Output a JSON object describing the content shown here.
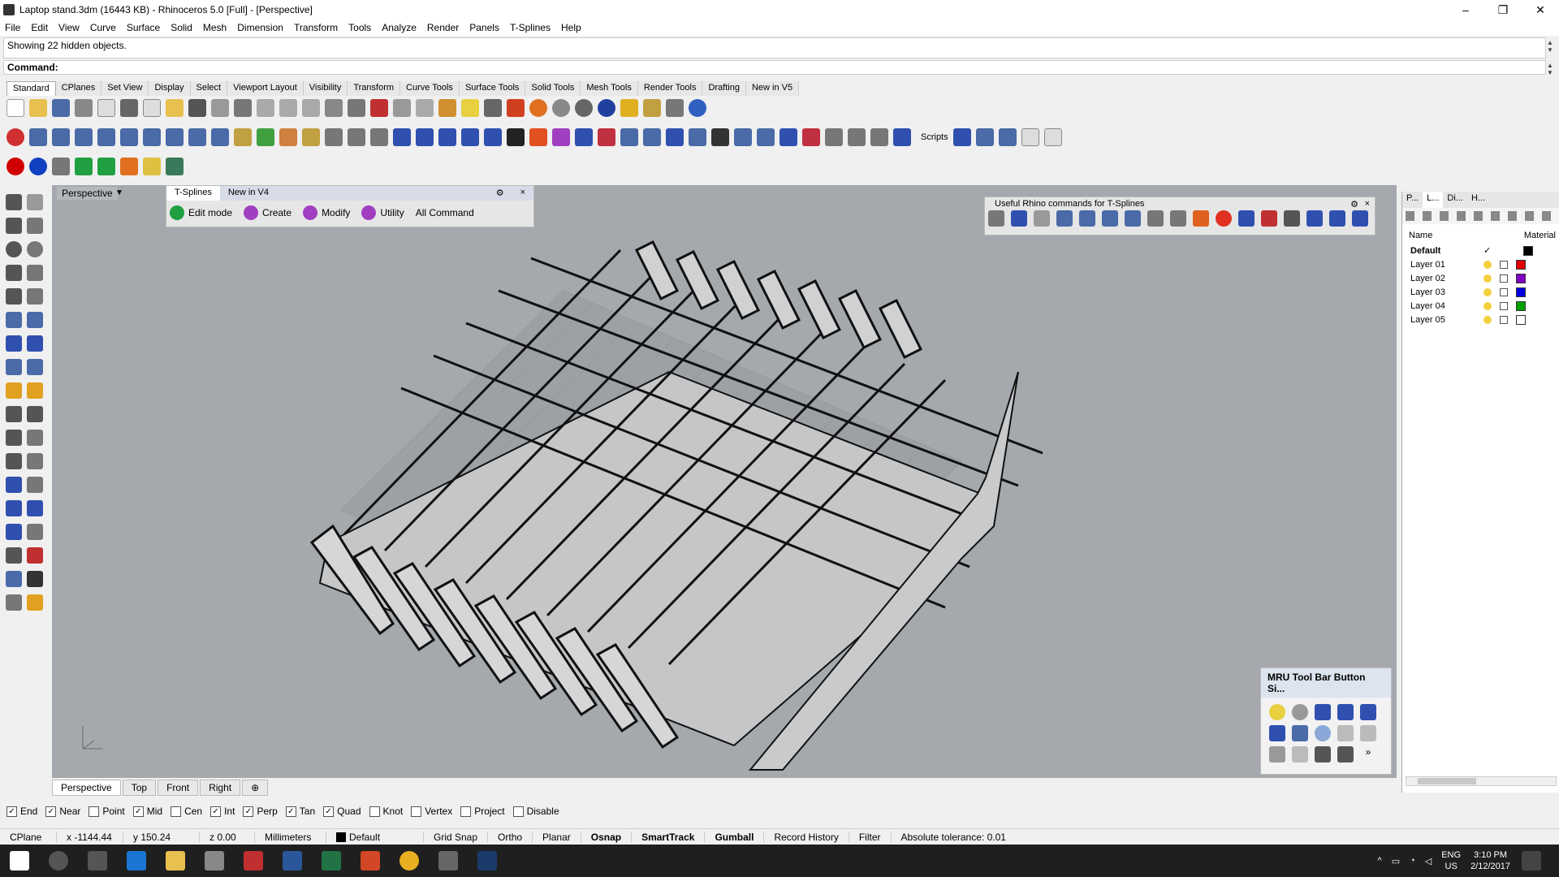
{
  "window": {
    "title": "Laptop stand.3dm (16443 KB) - Rhinoceros 5.0 [Full] - [Perspective]",
    "minimize": "–",
    "maximize": "❐",
    "close": "✕"
  },
  "menu": [
    "File",
    "Edit",
    "View",
    "Curve",
    "Surface",
    "Solid",
    "Mesh",
    "Dimension",
    "Transform",
    "Tools",
    "Analyze",
    "Render",
    "Panels",
    "T-Splines",
    "Help"
  ],
  "command": {
    "history": "Showing 22 hidden objects.",
    "prompt": "Command:"
  },
  "toolbar_tabs": [
    "Standard",
    "CPlanes",
    "Set View",
    "Display",
    "Select",
    "Viewport Layout",
    "Visibility",
    "Transform",
    "Curve Tools",
    "Surface Tools",
    "Solid Tools",
    "Mesh Tools",
    "Render Tools",
    "Drafting",
    "New in V5"
  ],
  "scripts_label": "Scripts",
  "viewport": {
    "label": "Perspective",
    "tabs": [
      "Perspective",
      "Top",
      "Front",
      "Right"
    ]
  },
  "tsplines_panel": {
    "tabs": [
      "T-Splines",
      "New in V4"
    ],
    "tools": [
      "Edit mode",
      "Create",
      "Modify",
      "Utility",
      "All Command"
    ]
  },
  "useful_panel": {
    "title": "Useful Rhino commands for T-Splines"
  },
  "mru_panel": {
    "title": "MRU Tool Bar Button Si..."
  },
  "layers": {
    "tabs": [
      "P...",
      "L...",
      "Di...",
      "H..."
    ],
    "col_name": "Name",
    "col_material": "Material",
    "rows": [
      {
        "name": "Default",
        "color": "#000000"
      },
      {
        "name": "Layer 01",
        "color": "#e00000"
      },
      {
        "name": "Layer 02",
        "color": "#8000c0"
      },
      {
        "name": "Layer 03",
        "color": "#0000e0"
      },
      {
        "name": "Layer 04",
        "color": "#00a000"
      },
      {
        "name": "Layer 05",
        "color": "#ffffff"
      }
    ]
  },
  "osnap": [
    {
      "label": "End",
      "checked": true
    },
    {
      "label": "Near",
      "checked": true
    },
    {
      "label": "Point",
      "checked": false
    },
    {
      "label": "Mid",
      "checked": true
    },
    {
      "label": "Cen",
      "checked": false
    },
    {
      "label": "Int",
      "checked": true
    },
    {
      "label": "Perp",
      "checked": true
    },
    {
      "label": "Tan",
      "checked": true
    },
    {
      "label": "Quad",
      "checked": true
    },
    {
      "label": "Knot",
      "checked": false
    },
    {
      "label": "Vertex",
      "checked": false
    },
    {
      "label": "Project",
      "checked": false
    },
    {
      "label": "Disable",
      "checked": false
    }
  ],
  "status": {
    "cplane": "CPlane",
    "x": "x -1144.44",
    "y": "y 150.24",
    "z": "z 0.00",
    "units": "Millimeters",
    "layer": "Default",
    "grid_snap": "Grid Snap",
    "ortho": "Ortho",
    "planar": "Planar",
    "osnap": "Osnap",
    "smarttrack": "SmartTrack",
    "gumball": "Gumball",
    "record_history": "Record History",
    "filter": "Filter",
    "tolerance": "Absolute tolerance: 0.01"
  },
  "taskbar": {
    "lang": "ENG",
    "region": "US",
    "time": "3:10 PM",
    "date": "2/12/2017"
  }
}
